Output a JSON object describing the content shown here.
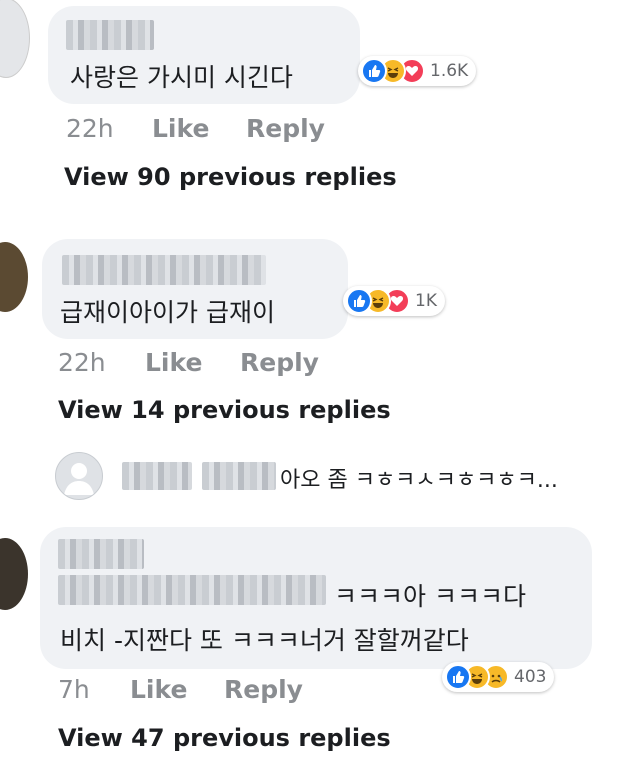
{
  "comments": [
    {
      "text": "사랑은 가시미 시긴다",
      "reaction_count": "1.6K",
      "time": "22h",
      "like_label": "Like",
      "reply_label": "Reply",
      "view_replies": "View 90 previous replies"
    },
    {
      "text": "급재이아이가 급재이",
      "reaction_count": "1K",
      "time": "22h",
      "like_label": "Like",
      "reply_label": "Reply",
      "view_replies": "View 14 previous replies"
    },
    {
      "text_line1": "ㅋㅋㅋ아 ㅋㅋㅋ다",
      "text_line2": "비치 -지짠다 또 ㅋㅋㅋ너거 잘할꺼같다",
      "reaction_count": "403",
      "time": "7h",
      "like_label": "Like",
      "reply_label": "Reply",
      "view_replies": "View 47 previous replies"
    }
  ],
  "reply_preview": {
    "text": "아오 좀 ㅋㅎㅋㅅㅋㅎㅋㅎㅋ..."
  },
  "colors": {
    "bubble": "#f0f2f5",
    "meta": "#8a8d91",
    "like": "#1877f2",
    "haha": "#f7b928",
    "love": "#f33e58"
  },
  "icons": [
    "like-icon",
    "haha-icon",
    "love-icon",
    "sad-icon",
    "avatar-placeholder-icon"
  ]
}
